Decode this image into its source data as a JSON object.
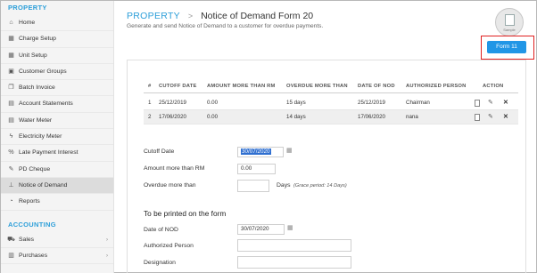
{
  "sidebar": {
    "sections": [
      {
        "title": "PROPERTY",
        "items": [
          {
            "label": "Home",
            "icon": "home-icon"
          },
          {
            "label": "Charge Setup",
            "icon": "grid-icon"
          },
          {
            "label": "Unit Setup",
            "icon": "grid-icon"
          },
          {
            "label": "Customer Groups",
            "icon": "users-icon"
          },
          {
            "label": "Batch Invoice",
            "icon": "copy-icon"
          },
          {
            "label": "Account Statements",
            "icon": "document-icon"
          },
          {
            "label": "Water Meter",
            "icon": "document-icon"
          },
          {
            "label": "Electricity Meter",
            "icon": "lightning-icon"
          },
          {
            "label": "Late Payment Interest",
            "icon": "percent-icon"
          },
          {
            "label": "PD Cheque",
            "icon": "pencil-icon"
          },
          {
            "label": "Notice of Demand",
            "icon": "pin-icon"
          },
          {
            "label": "Reports",
            "icon": "chart-icon"
          }
        ]
      },
      {
        "title": "ACCOUNTING",
        "items": [
          {
            "label": "Sales",
            "icon": "cart-icon"
          },
          {
            "label": "Purchases",
            "icon": "bag-icon"
          }
        ]
      }
    ]
  },
  "header": {
    "breadcrumb_root": "PROPERTY",
    "title": "Notice of Demand Form 20",
    "subtitle": "Generate and send Notice of Demand to a customer for overdue payments.",
    "avatar_label": "Sample",
    "form_button": "Form 11"
  },
  "table": {
    "columns": [
      "#",
      "CUTOFF DATE",
      "AMOUNT MORE THAN RM",
      "OVERDUE MORE THAN",
      "DATE OF NOD",
      "AUTHORIZED PERSON",
      "ACTION"
    ],
    "rows": [
      {
        "num": "1",
        "cutoff": "25/12/2019",
        "amount": "0.00",
        "overdue": "15 days",
        "nod": "25/12/2019",
        "person": "Chairman"
      },
      {
        "num": "2",
        "cutoff": "17/06/2020",
        "amount": "0.00",
        "overdue": "14 days",
        "nod": "17/06/2020",
        "person": "nana"
      }
    ]
  },
  "form": {
    "cutoff_label": "Cutoff Date",
    "cutoff_value": "30/07/2020",
    "amount_label": "Amount more than RM",
    "amount_value": "0.00",
    "overdue_label": "Overdue more than",
    "overdue_value": "",
    "overdue_unit": "Days",
    "overdue_hint": "(Grace period: 14 Days)",
    "print_section": "To be printed on the form",
    "nod_label": "Date of NOD",
    "nod_value": "30/07/2020",
    "auth_label": "Authorized Person",
    "auth_value": "",
    "designation_label": "Designation",
    "designation_value": ""
  },
  "colors": {
    "accent": "#2d9fd9",
    "button": "#2196e6",
    "highlight": "#e02020",
    "selection": "#2f6fd0"
  }
}
